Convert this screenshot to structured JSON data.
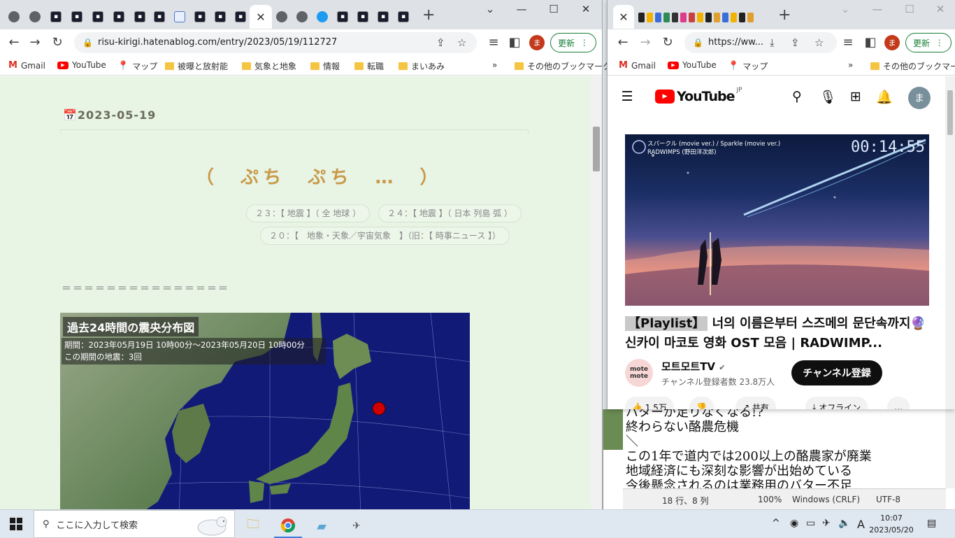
{
  "left_window": {
    "url": "risu-kirigi.hatenablog.com/entry/2023/05/19/112727",
    "update_label": "更新",
    "avatar_letter": "ま",
    "bookmarks": [
      "Gmail",
      "YouTube",
      "マップ",
      "被曝と放射能",
      "気象と地象",
      "情報",
      "転職",
      "まいあみ"
    ],
    "bookmarks_more": "»",
    "other_bookmarks": "その他のブックマーク",
    "window_controls": {
      "minimize": "⌄",
      "maximize": "☐",
      "close": "✕"
    },
    "page": {
      "date": "2023-05-19",
      "title": "（　ぷち　ぷち　…　）",
      "categories": [
        "２３：【 地震 】（ 全 地球 ）",
        "２４：【 地震 】（ 日本 列島 弧 ）",
        "２０：【　地象・天象／宇宙気象　】（旧：【 時事ニュース 】）"
      ],
      "separator": "＝＝＝＝＝＝＝＝＝＝＝＝＝＝＝",
      "map_title": "過去24時間の震央分布図",
      "map_period": "期間：2023年05月19日 10時00分～2023年05月20日 10時00分",
      "map_count": "この期間の地震：3回"
    }
  },
  "right_window": {
    "url": "https://ww...",
    "update_label": "更新",
    "avatar_letter": "ま",
    "bookmarks": [
      "Gmail",
      "YouTube",
      "マップ"
    ],
    "bookmarks_more": "»",
    "other_bookmarks": "その他のブックマーク",
    "youtube": {
      "logo_text": "YouTube",
      "region": "JP",
      "avatar_letter": "ま",
      "thumbnail_header_line1": "スパークル (movie ver.) / Sparkle (movie ver.)",
      "thumbnail_header_line2": "RADWIMPS (野田洋次郎)",
      "thumbnail_time": "00:14:55",
      "title_tag": "【Playlist】",
      "title_rest": " 너의 이름은부터 스즈메의 문단속까지🔮 신카이 마코토 영화 OST 모음 | RADWIMP...",
      "channel_avatar": "mote\nmote",
      "channel_name": "모트모트TV",
      "verified": "✔",
      "subscribers": "チャンネル登録者数 23.8万人",
      "subscribe_label": "チャンネル登録",
      "chips": [
        "1.5万",
        "",
        "共有",
        "オフライン",
        "…"
      ]
    }
  },
  "notepad": {
    "text": "バターが足りなくなる!?\n終わらない酪農危機\n＼\nこの1年で道内では200以上の酪農家が廃業\n地域経済にも深刻な影響が出始めている\n今後懸念されるのは業務用のバター不足",
    "status": {
      "position": "18 行、8 列",
      "zoom": "100%",
      "eol": "Windows (CRLF)",
      "encoding": "UTF-8"
    }
  },
  "taskbar": {
    "search_placeholder": "ここに入力して検索",
    "ime": "A",
    "time": "10:07",
    "date": "2023/05/20"
  }
}
